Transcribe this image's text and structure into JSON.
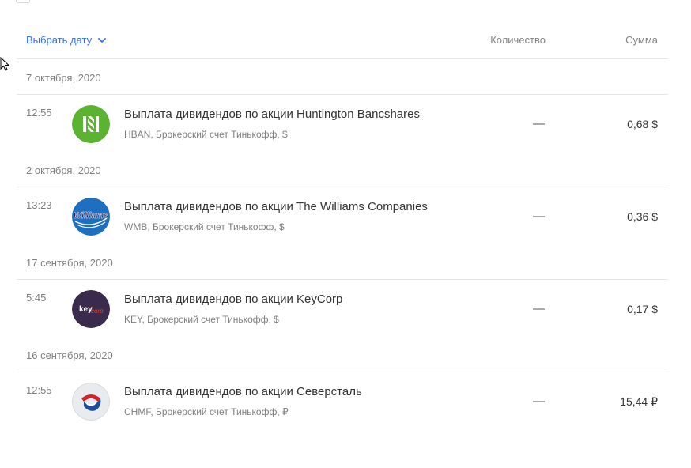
{
  "header": {
    "date_picker_label": "Выбрать дату",
    "quantity_header": "Количество",
    "sum_header": "Сумма"
  },
  "groups": [
    {
      "date": "7 октября, 2020",
      "operations": [
        {
          "time": "12:55",
          "logo": "huntington-logo-icon",
          "title": "Выплата дивидендов по акции Huntington Bancshares",
          "subtitle": "HBAN, Брокерский счет Тинькофф, $",
          "quantity": "—",
          "sum": "0,68 $"
        }
      ]
    },
    {
      "date": "2 октября, 2020",
      "operations": [
        {
          "time": "13:23",
          "logo": "williams-logo-icon",
          "logo_text": "Williams",
          "title": "Выплата дивидендов по акции The Williams Companies",
          "subtitle": "WMB, Брокерский счет Тинькофф, $",
          "quantity": "—",
          "sum": "0,36 $"
        }
      ]
    },
    {
      "date": "17 сентября, 2020",
      "operations": [
        {
          "time": "5:45",
          "logo": "keycorp-logo-icon",
          "logo_text_key": "key",
          "logo_text_corp": "corp",
          "title": "Выплата дивидендов по акции KeyCorp",
          "subtitle": "KEY, Брокерский счет Тинькофф, $",
          "quantity": "—",
          "sum": "0,17 $"
        }
      ]
    },
    {
      "date": "16 сентября, 2020",
      "operations": [
        {
          "time": "12:55",
          "logo": "severstal-logo-icon",
          "title": "Выплата дивидендов по акции Северсталь",
          "subtitle": "CHMF, Брокерский счет Тинькофф, ₽",
          "quantity": "—",
          "sum": "15,44 ₽"
        }
      ]
    }
  ],
  "colors": {
    "accent": "#336fee",
    "huntington": "#5cb331",
    "williams": "#1e6fc0",
    "keycorp": "#3a2a4c",
    "severstal_red": "#d2232a",
    "severstal_blue": "#1d4e9c"
  }
}
